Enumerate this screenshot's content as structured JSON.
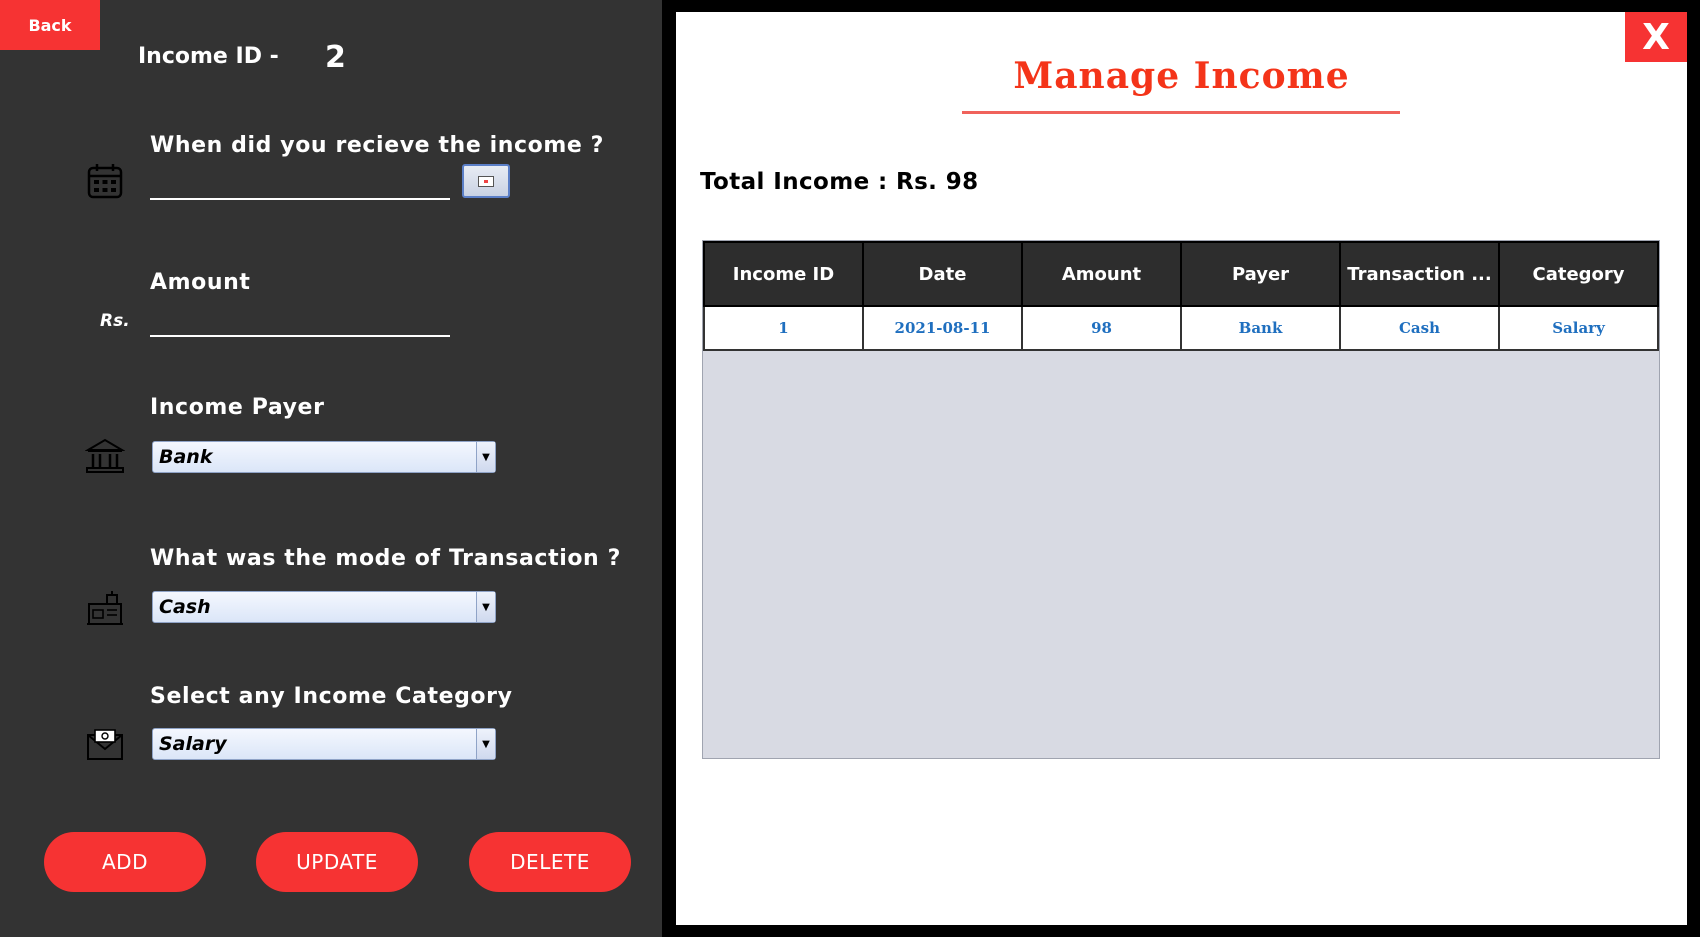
{
  "back_label": "Back",
  "income_id": {
    "label": "Income ID -",
    "value": "2"
  },
  "form": {
    "date_question": "When did you recieve the income ?",
    "amount_label": "Amount",
    "currency_prefix": "Rs.",
    "payer_label": "Income Payer",
    "payer_selected": "Bank",
    "mode_label": "What was the mode of Transaction ?",
    "mode_selected": "Cash",
    "category_label": "Select any Income Category",
    "category_selected": "Salary"
  },
  "buttons": {
    "add": "ADD",
    "update": "UPDATE",
    "delete": "DELETE"
  },
  "right": {
    "close_label": "X",
    "title": "Manage Income",
    "total": "Total Income : Rs. 98"
  },
  "table": {
    "columns": [
      "Income ID",
      "Date",
      "Amount",
      "Payer",
      "Transaction ...",
      "Category"
    ],
    "rows": [
      [
        "1",
        "2021-08-11",
        "98",
        "Bank",
        "Cash",
        "Salary"
      ]
    ]
  },
  "colors": {
    "accent": "#f63333",
    "title": "#f43419",
    "panel": "#333333",
    "cell_text": "#1f6fbf"
  },
  "icons": [
    "calendar-icon",
    "bank-icon",
    "cash-register-icon",
    "envelope-icon"
  ]
}
